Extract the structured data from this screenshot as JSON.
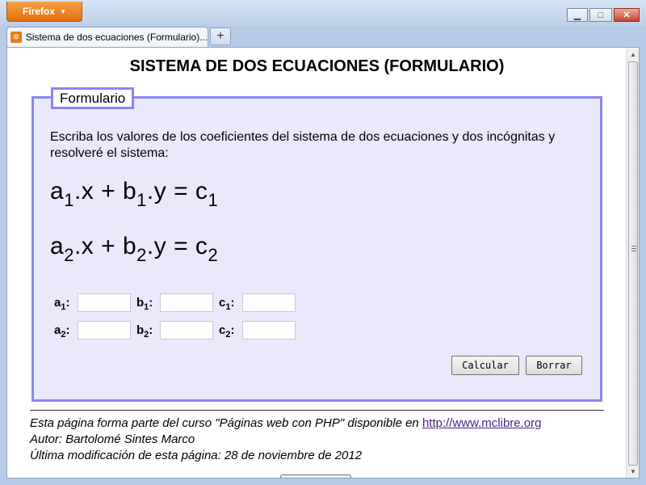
{
  "browser": {
    "app_button_label": "Firefox",
    "tab_title": "Sistema de dos ecuaciones (Formulario)....",
    "new_tab_label": "+"
  },
  "page": {
    "title": "SISTEMA DE DOS ECUACIONES (FORMULARIO)",
    "legend": "Formulario",
    "instructions": "Escriba los valores de los coeficientes del sistema de dos ecuaciones y dos incógnitas y resolveré el sistema:",
    "equations": [
      {
        "a": "a",
        "a_sub": "1",
        "x": ".x + b",
        "b_sub": "1",
        "y": ".y = c",
        "c_sub": "1"
      },
      {
        "a": "a",
        "a_sub": "2",
        "x": ".x + b",
        "b_sub": "2",
        "y": ".y = c",
        "c_sub": "2"
      }
    ],
    "coefficients": [
      {
        "a": "a",
        "a_sub": "1",
        "b": "b",
        "b_sub": "1",
        "c": "c",
        "c_sub": "1",
        "values": [
          "",
          "",
          ""
        ]
      },
      {
        "a": "a",
        "a_sub": "2",
        "b": "b",
        "b_sub": "2",
        "c": "c",
        "c_sub": "2",
        "values": [
          "",
          "",
          ""
        ]
      }
    ],
    "colon": ":",
    "buttons": {
      "calculate": "Calcular",
      "clear": "Borrar"
    }
  },
  "footer": {
    "line1_text": "Esta página forma parte del curso \"Páginas web con PHP\" disponible en ",
    "line1_link": "http://www.mclibre.org",
    "line2": "Autor: Bartolomé Sintes Marco",
    "line3": "Última modificación de esta página: 28 de noviembre de 2012"
  },
  "colors": {
    "fieldset_border": "#8787f0",
    "fieldset_bg": "#e9e9fb",
    "firefox_orange": "#e26d09"
  }
}
